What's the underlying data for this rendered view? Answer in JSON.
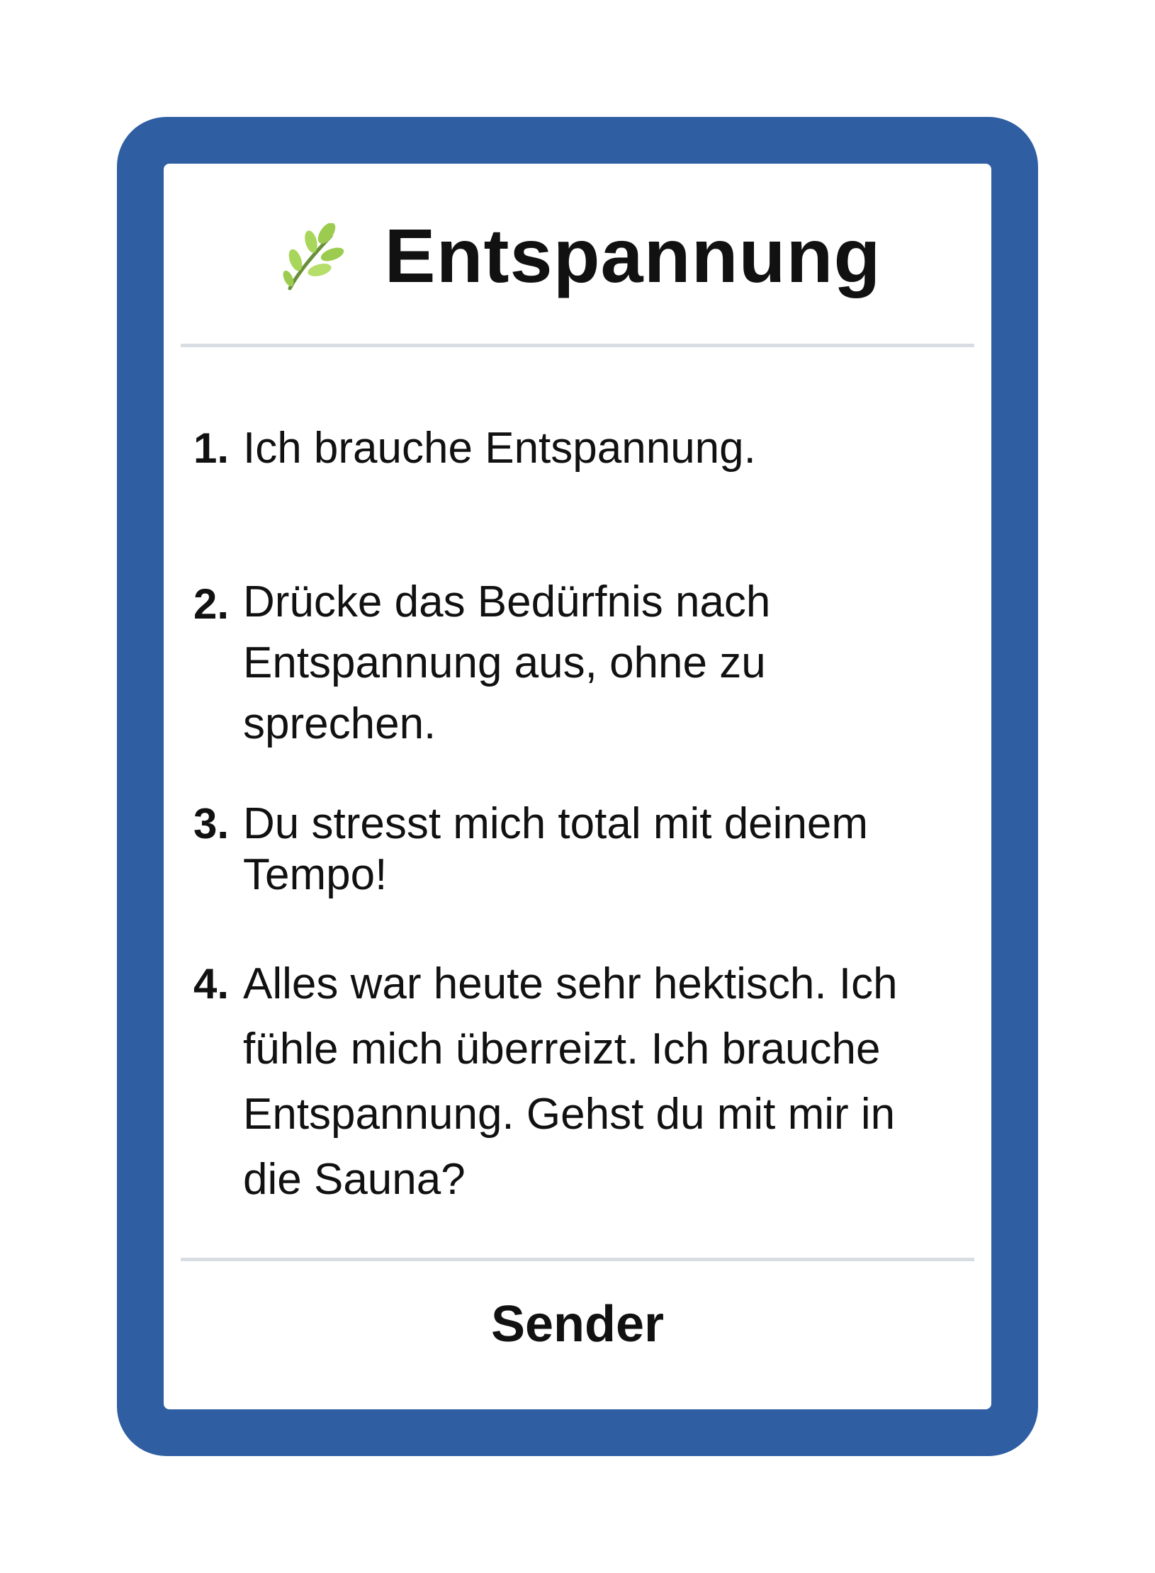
{
  "card": {
    "title": "Entspannung",
    "icon": "herb-sprig-icon",
    "border_color": "#2f5ea3",
    "items": [
      {
        "number": "1.",
        "text": "Ich brauche Entspannung."
      },
      {
        "number": "2.",
        "text": "Drücke das Bedürfnis nach Entspannung aus, ohne zu sprechen."
      },
      {
        "number": "3.",
        "text": "Du stresst mich total mit deinem Tempo!"
      },
      {
        "number": "4.",
        "text": "Alles war heute sehr hektisch. Ich fühle mich überreizt. Ich brauche Entspannung. Gehst du mit mir in die Sauna?"
      }
    ],
    "footer": "Sender"
  }
}
